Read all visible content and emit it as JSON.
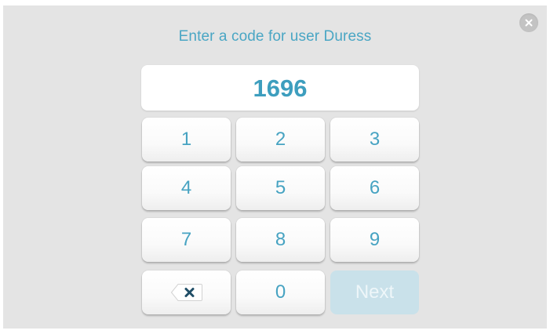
{
  "dialog": {
    "title": "Enter a code for user Duress",
    "code_value": "1696",
    "close_icon": "close-icon"
  },
  "keypad": {
    "keys": [
      "1",
      "2",
      "3",
      "4",
      "5",
      "6",
      "7",
      "8",
      "9"
    ],
    "zero": "0",
    "backspace_icon": "backspace-icon",
    "next_label": "Next",
    "next_enabled": false
  },
  "colors": {
    "accent": "#47a3c2",
    "background": "#e4e4e4",
    "disabled_button": "#c9e1ea"
  }
}
